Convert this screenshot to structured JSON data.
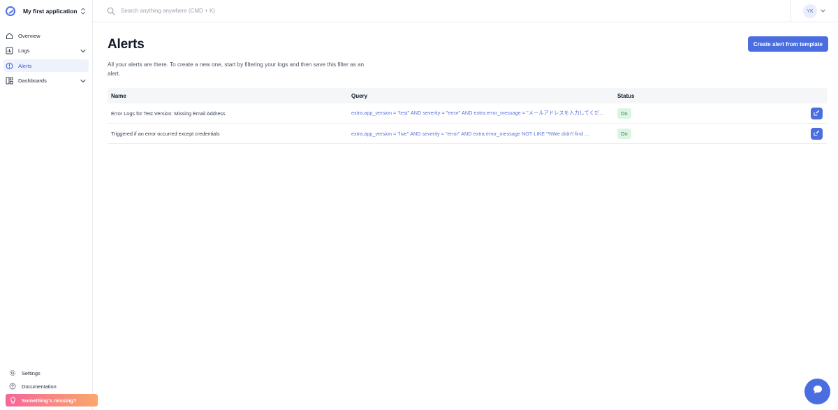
{
  "sidebar": {
    "app_name": "My first application",
    "items": [
      {
        "label": "Overview",
        "icon": "home-icon"
      },
      {
        "label": "Logs",
        "icon": "logs-icon"
      },
      {
        "label": "Alerts",
        "icon": "alert-icon"
      },
      {
        "label": "Dashboards",
        "icon": "dashboard-icon"
      }
    ],
    "bottom": {
      "settings_label": "Settings",
      "documentation_label": "Documentation",
      "missing_label": "Something's missing?"
    }
  },
  "topbar": {
    "search_placeholder": "Search anything anywhere (CMD + K)",
    "user_initials": "YK"
  },
  "page": {
    "title": "Alerts",
    "description": "All your alerts are there. To create a new one, start by filtering your logs and then save this filter as an alert.",
    "create_button": "Create alert from template"
  },
  "table": {
    "headers": {
      "name": "Name",
      "query": "Query",
      "status": "Status"
    },
    "rows": [
      {
        "name": "Error Logs for Test Version: Missing Email Address",
        "query": "extra.app_version = \"test\" AND severity = \"error\" AND extra.error_message = \"メールアドレスを入力してくだ...",
        "status": "On"
      },
      {
        "name": "Triggered if an error occurred except credentials",
        "query": "extra.app_version = \"live\" AND severity = \"error\" AND extra.error_message NOT LIKE \"%We didn't find ...",
        "status": "On"
      }
    ]
  },
  "colors": {
    "accent": "#4a6ee0",
    "active_nav_bg": "#eef2fb",
    "status_on_bg": "#dcf5e3",
    "status_on_text": "#2f7d48",
    "missing_gradient_start": "#f7659a",
    "missing_gradient_end": "#f9a86b"
  }
}
